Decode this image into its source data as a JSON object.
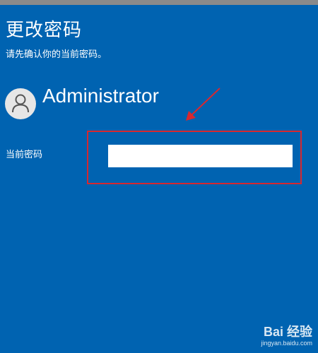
{
  "dialog": {
    "title": "更改密码",
    "subtitle": "请先确认你的当前密码。"
  },
  "user": {
    "name": "Administrator",
    "avatar_icon": "person-icon"
  },
  "form": {
    "current_password_label": "当前密码",
    "current_password_value": ""
  },
  "annotation": {
    "box_color": "#d8282f",
    "arrow_color": "#d8282f"
  },
  "watermark": {
    "logo": "Bai 经验",
    "url": "jingyan.baidu.com"
  },
  "colors": {
    "background": "#0063b1",
    "topbar": "#8a8a8a",
    "text": "#ffffff"
  }
}
